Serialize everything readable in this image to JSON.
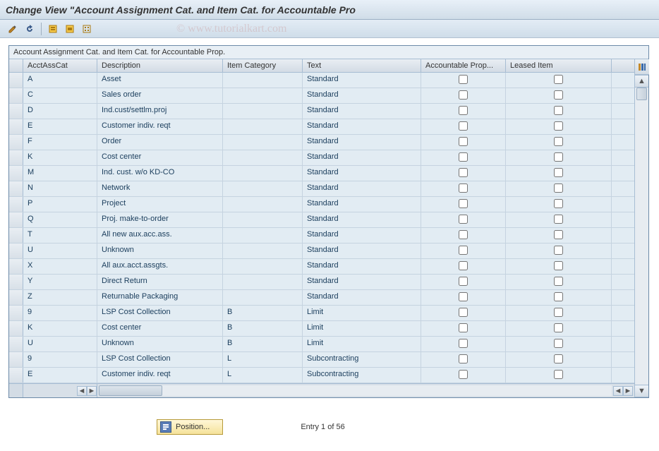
{
  "header": {
    "title": "Change View \"Account Assignment Cat. and Item Cat. for Accountable Pro"
  },
  "toolbar": {
    "icons": [
      "change-icon",
      "undo-icon",
      "select-all-icon",
      "select-block-icon",
      "deselect-icon"
    ]
  },
  "watermark": "© www.tutorialkart.com",
  "table": {
    "title": "Account Assignment Cat. and Item Cat. for Accountable Prop.",
    "columns": {
      "acc": "AcctAssCat",
      "desc": "Description",
      "cat": "Item Category",
      "text": "Text",
      "prop": "Accountable Prop...",
      "leased": "Leased Item"
    },
    "rows": [
      {
        "acc": "A",
        "desc": "Asset",
        "cat": "",
        "text": "Standard",
        "prop": false,
        "leased": false
      },
      {
        "acc": "C",
        "desc": "Sales order",
        "cat": "",
        "text": "Standard",
        "prop": false,
        "leased": false
      },
      {
        "acc": "D",
        "desc": "Ind.cust/settlm.proj",
        "cat": "",
        "text": "Standard",
        "prop": false,
        "leased": false
      },
      {
        "acc": "E",
        "desc": "Customer indiv. reqt",
        "cat": "",
        "text": "Standard",
        "prop": false,
        "leased": false
      },
      {
        "acc": "F",
        "desc": "Order",
        "cat": "",
        "text": "Standard",
        "prop": false,
        "leased": false
      },
      {
        "acc": "K",
        "desc": "Cost center",
        "cat": "",
        "text": "Standard",
        "prop": false,
        "leased": false
      },
      {
        "acc": "M",
        "desc": "Ind. cust. w/o KD-CO",
        "cat": "",
        "text": "Standard",
        "prop": false,
        "leased": false
      },
      {
        "acc": "N",
        "desc": "Network",
        "cat": "",
        "text": "Standard",
        "prop": false,
        "leased": false
      },
      {
        "acc": "P",
        "desc": "Project",
        "cat": "",
        "text": "Standard",
        "prop": false,
        "leased": false
      },
      {
        "acc": "Q",
        "desc": "Proj. make-to-order",
        "cat": "",
        "text": "Standard",
        "prop": false,
        "leased": false
      },
      {
        "acc": "T",
        "desc": "All new aux.acc.ass.",
        "cat": "",
        "text": "Standard",
        "prop": false,
        "leased": false
      },
      {
        "acc": "U",
        "desc": "Unknown",
        "cat": "",
        "text": "Standard",
        "prop": false,
        "leased": false
      },
      {
        "acc": "X",
        "desc": "All aux.acct.assgts.",
        "cat": "",
        "text": "Standard",
        "prop": false,
        "leased": false
      },
      {
        "acc": "Y",
        "desc": "Direct Return",
        "cat": "",
        "text": "Standard",
        "prop": false,
        "leased": false
      },
      {
        "acc": "Z",
        "desc": "Returnable Packaging",
        "cat": "",
        "text": "Standard",
        "prop": false,
        "leased": false
      },
      {
        "acc": "9",
        "desc": "LSP Cost Collection",
        "cat": "B",
        "text": "Limit",
        "prop": false,
        "leased": false
      },
      {
        "acc": "K",
        "desc": "Cost center",
        "cat": "B",
        "text": "Limit",
        "prop": false,
        "leased": false
      },
      {
        "acc": "U",
        "desc": "Unknown",
        "cat": "B",
        "text": "Limit",
        "prop": false,
        "leased": false
      },
      {
        "acc": "9",
        "desc": "LSP Cost Collection",
        "cat": "L",
        "text": "Subcontracting",
        "prop": false,
        "leased": false
      },
      {
        "acc": "E",
        "desc": "Customer indiv. reqt",
        "cat": "L",
        "text": "Subcontracting",
        "prop": false,
        "leased": false
      }
    ]
  },
  "footer": {
    "position_label": "Position...",
    "entry_text": "Entry 1 of 56"
  }
}
